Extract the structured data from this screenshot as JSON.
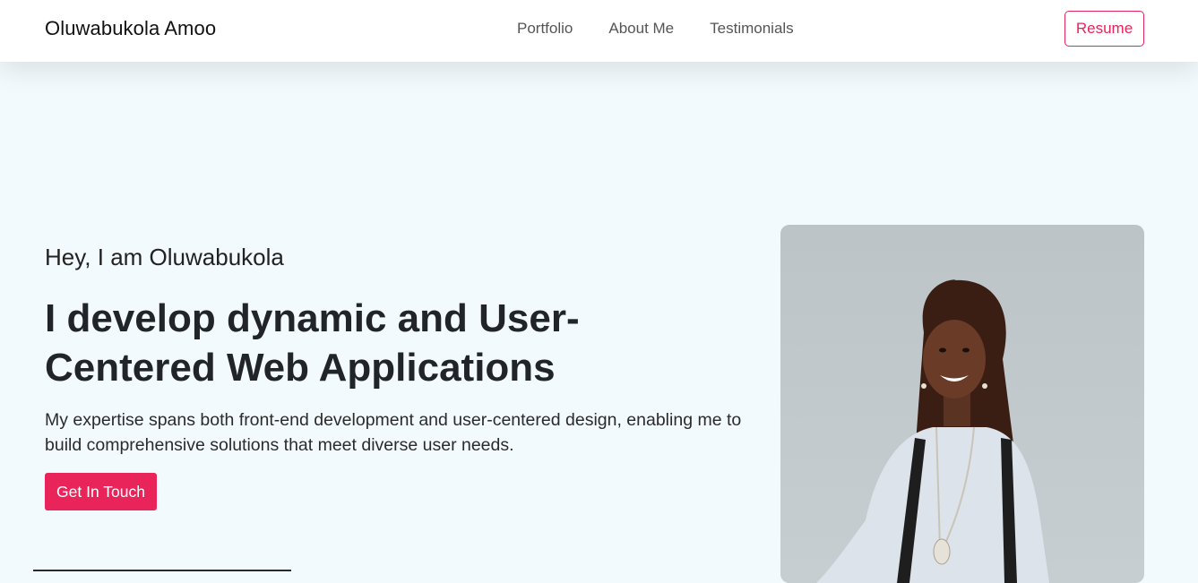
{
  "nav": {
    "brand": "Oluwabukola Amoo",
    "links": [
      {
        "label": "Portfolio"
      },
      {
        "label": "About Me"
      },
      {
        "label": "Testimonials"
      }
    ],
    "resume_label": "Resume"
  },
  "hero": {
    "intro": "Hey, I am Oluwabukola",
    "title": "I develop dynamic and User-Centered Web Applications",
    "description": "My expertise spans both front-end development and user-centered design, enabling me to build comprehensive solutions that meet diverse user needs.",
    "cta_label": "Get In Touch",
    "photo_icon": "portrait-photo"
  },
  "colors": {
    "accent": "#e8245a",
    "background": "#f3fafd",
    "navbar": "#ffffff",
    "text": "#212529"
  }
}
